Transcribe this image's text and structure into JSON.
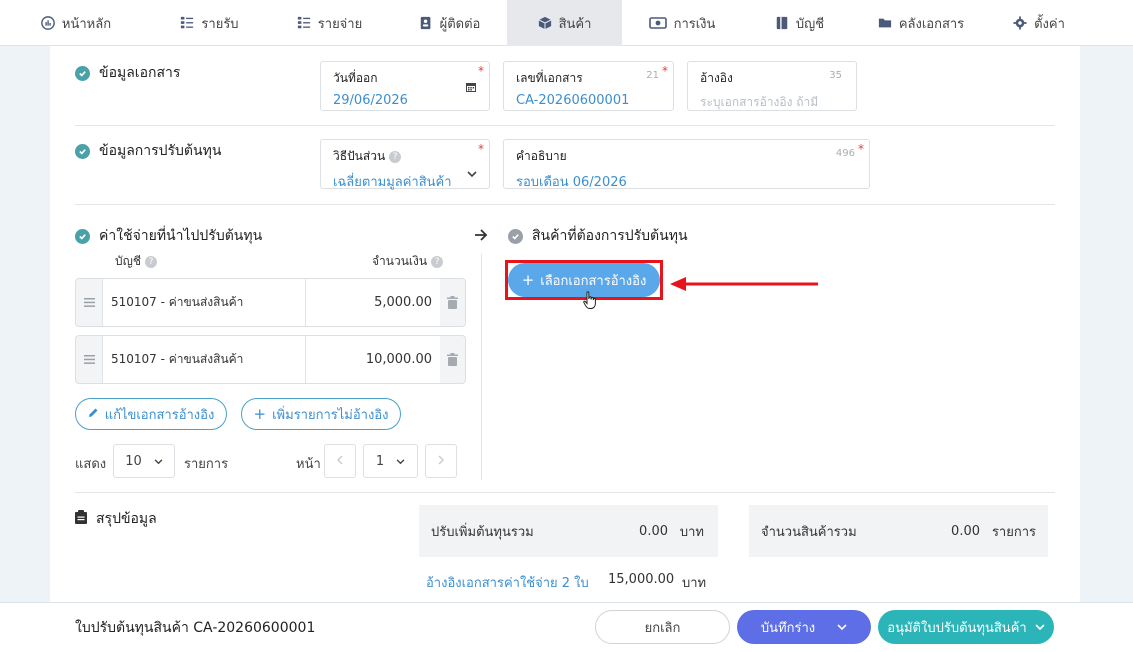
{
  "nav": {
    "items": [
      {
        "label": "หน้าหลัก",
        "icon": "dashboard-icon"
      },
      {
        "label": "รายรับ",
        "icon": "income-icon"
      },
      {
        "label": "รายจ่าย",
        "icon": "expense-icon"
      },
      {
        "label": "ผู้ติดต่อ",
        "icon": "contacts-icon"
      },
      {
        "label": "สินค้า",
        "icon": "product-box-icon"
      },
      {
        "label": "การเงิน",
        "icon": "money-icon"
      },
      {
        "label": "บัญชี",
        "icon": "ledger-icon"
      },
      {
        "label": "คลังเอกสาร",
        "icon": "folder-icon"
      },
      {
        "label": "ตั้งค่า",
        "icon": "gear-icon"
      }
    ]
  },
  "doc_info": {
    "title": "ข้อมูลเอกสาร",
    "issue_date": {
      "label": "วันที่ออก",
      "value": "29/06/2026"
    },
    "doc_no": {
      "label": "เลขที่เอกสาร",
      "value": "CA-20260600001",
      "count": "21"
    },
    "reference": {
      "label": "อ้างอิง",
      "placeholder": "ระบุเอกสารอ้างอิง ถ้ามี",
      "count": "35"
    }
  },
  "cost_adjust": {
    "title": "ข้อมูลการปรับต้นทุน",
    "method": {
      "label": "วิธีปันส่วน",
      "value": "เฉลี่ยตามมูลค่าสินค้า"
    },
    "description": {
      "label": "คำอธิบาย",
      "value": "รอบเดือน 06/2026",
      "count": "496"
    }
  },
  "expenses": {
    "title": "ค่าใช้จ่ายที่นำไปปรับต้นทุน",
    "col_account": "บัญชี",
    "col_amount": "จำนวนเงิน",
    "rows": [
      {
        "account": "510107 - ค่าขนส่งสินค้า",
        "amount": "5,000.00"
      },
      {
        "account": "510107 - ค่าขนส่งสินค้า",
        "amount": "10,000.00"
      }
    ],
    "edit_ref_label": "แก้ไขเอกสารอ้างอิง",
    "add_item_label": "เพิ่มรายการไม่อ้างอิง",
    "show_label": "แสดง",
    "page_size": "10",
    "items_label": "รายการ",
    "page_label": "หน้า",
    "page_value": "1"
  },
  "products": {
    "title": "สินค้าที่ต้องการปรับต้นทุน",
    "select_ref_label": "เลือกเอกสารอ้างอิง"
  },
  "summary": {
    "title": "สรุปข้อมูล",
    "total_increase_label": "ปรับเพิ่มต้นทุนรวม",
    "total_increase_value": "0.00",
    "currency": "บาท",
    "total_products_label": "จำนวนสินค้ารวม",
    "total_products_value": "0.00",
    "products_unit": "รายการ",
    "ref_docs_label": "อ้างอิงเอกสารค่าใช้จ่าย 2 ใบ",
    "ref_docs_value": "15,000.00",
    "ref_docs_unit": "บาท"
  },
  "footer": {
    "doc_title": "ใบปรับต้นทุนสินค้า CA-20260600001",
    "cancel_label": "ยกเลิก",
    "save_draft_label": "บันทึกร่าง",
    "approve_label": "อนุมัติใบปรับต้นทุนสินค้า"
  },
  "colors": {
    "accent": "#4aa1a8",
    "primary": "#5d6ee6",
    "teal": "#2cb5b9",
    "highlight": "#e8141b"
  }
}
